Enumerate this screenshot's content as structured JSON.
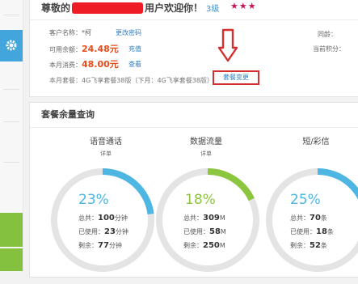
{
  "header": {
    "greeting_prefix": "尊敬的",
    "greeting_suffix": "用户欢迎你！",
    "level": "3级"
  },
  "account": {
    "name_label": "客户名称：*柯",
    "change_password": "更改密码",
    "balance_label": "可用余额：",
    "balance_value": "24.48元",
    "recharge": "充值",
    "spend_label": "本月消费：",
    "spend_value": "48.00元",
    "view": "查看",
    "package_text": "本月套餐：4G飞享套餐38版（下月：4G飞享套餐38版）",
    "package_change": "套餐变更",
    "right_label_1": "同龄：",
    "right_label_2": "当前积分："
  },
  "usage": {
    "title": "套餐余量查询",
    "columns": [
      {
        "title": "语音通话",
        "detail": "详单",
        "percent": "23%",
        "fraction": 0.23,
        "color": "#4db6e2",
        "total_label": "总共：",
        "total_value": "100",
        "total_unit": "分钟",
        "used_label": "已使用：",
        "used_value": "23",
        "used_unit": "分钟",
        "left_label": "剩余：",
        "left_value": "77",
        "left_unit": "分钟"
      },
      {
        "title": "数据流量",
        "detail": "详单",
        "percent": "18%",
        "fraction": 0.18,
        "color": "#8cc63f",
        "total_label": "总共：",
        "total_value": "309",
        "total_unit": "M",
        "used_label": "已使用：",
        "used_value": "58",
        "used_unit": "M",
        "left_label": "剩余：",
        "left_value": "250",
        "left_unit": "M"
      },
      {
        "title": "短/彩信",
        "detail": "",
        "percent": "25%",
        "fraction": 0.25,
        "color": "#4db6e2",
        "total_label": "总共：",
        "total_value": "70",
        "total_unit": "条",
        "used_label": "已使用：",
        "used_value": "18",
        "used_unit": "条",
        "left_label": "剩余：",
        "left_value": "52",
        "left_unit": "条"
      }
    ]
  },
  "colors": {
    "accent_blue": "#42a5dc",
    "accent_green": "#84c13e",
    "highlight_red": "#d32f2f",
    "amount_orange": "#e84c1a"
  },
  "icons": [
    "gear-icon",
    "down-arrow-icon",
    "star-icon"
  ]
}
